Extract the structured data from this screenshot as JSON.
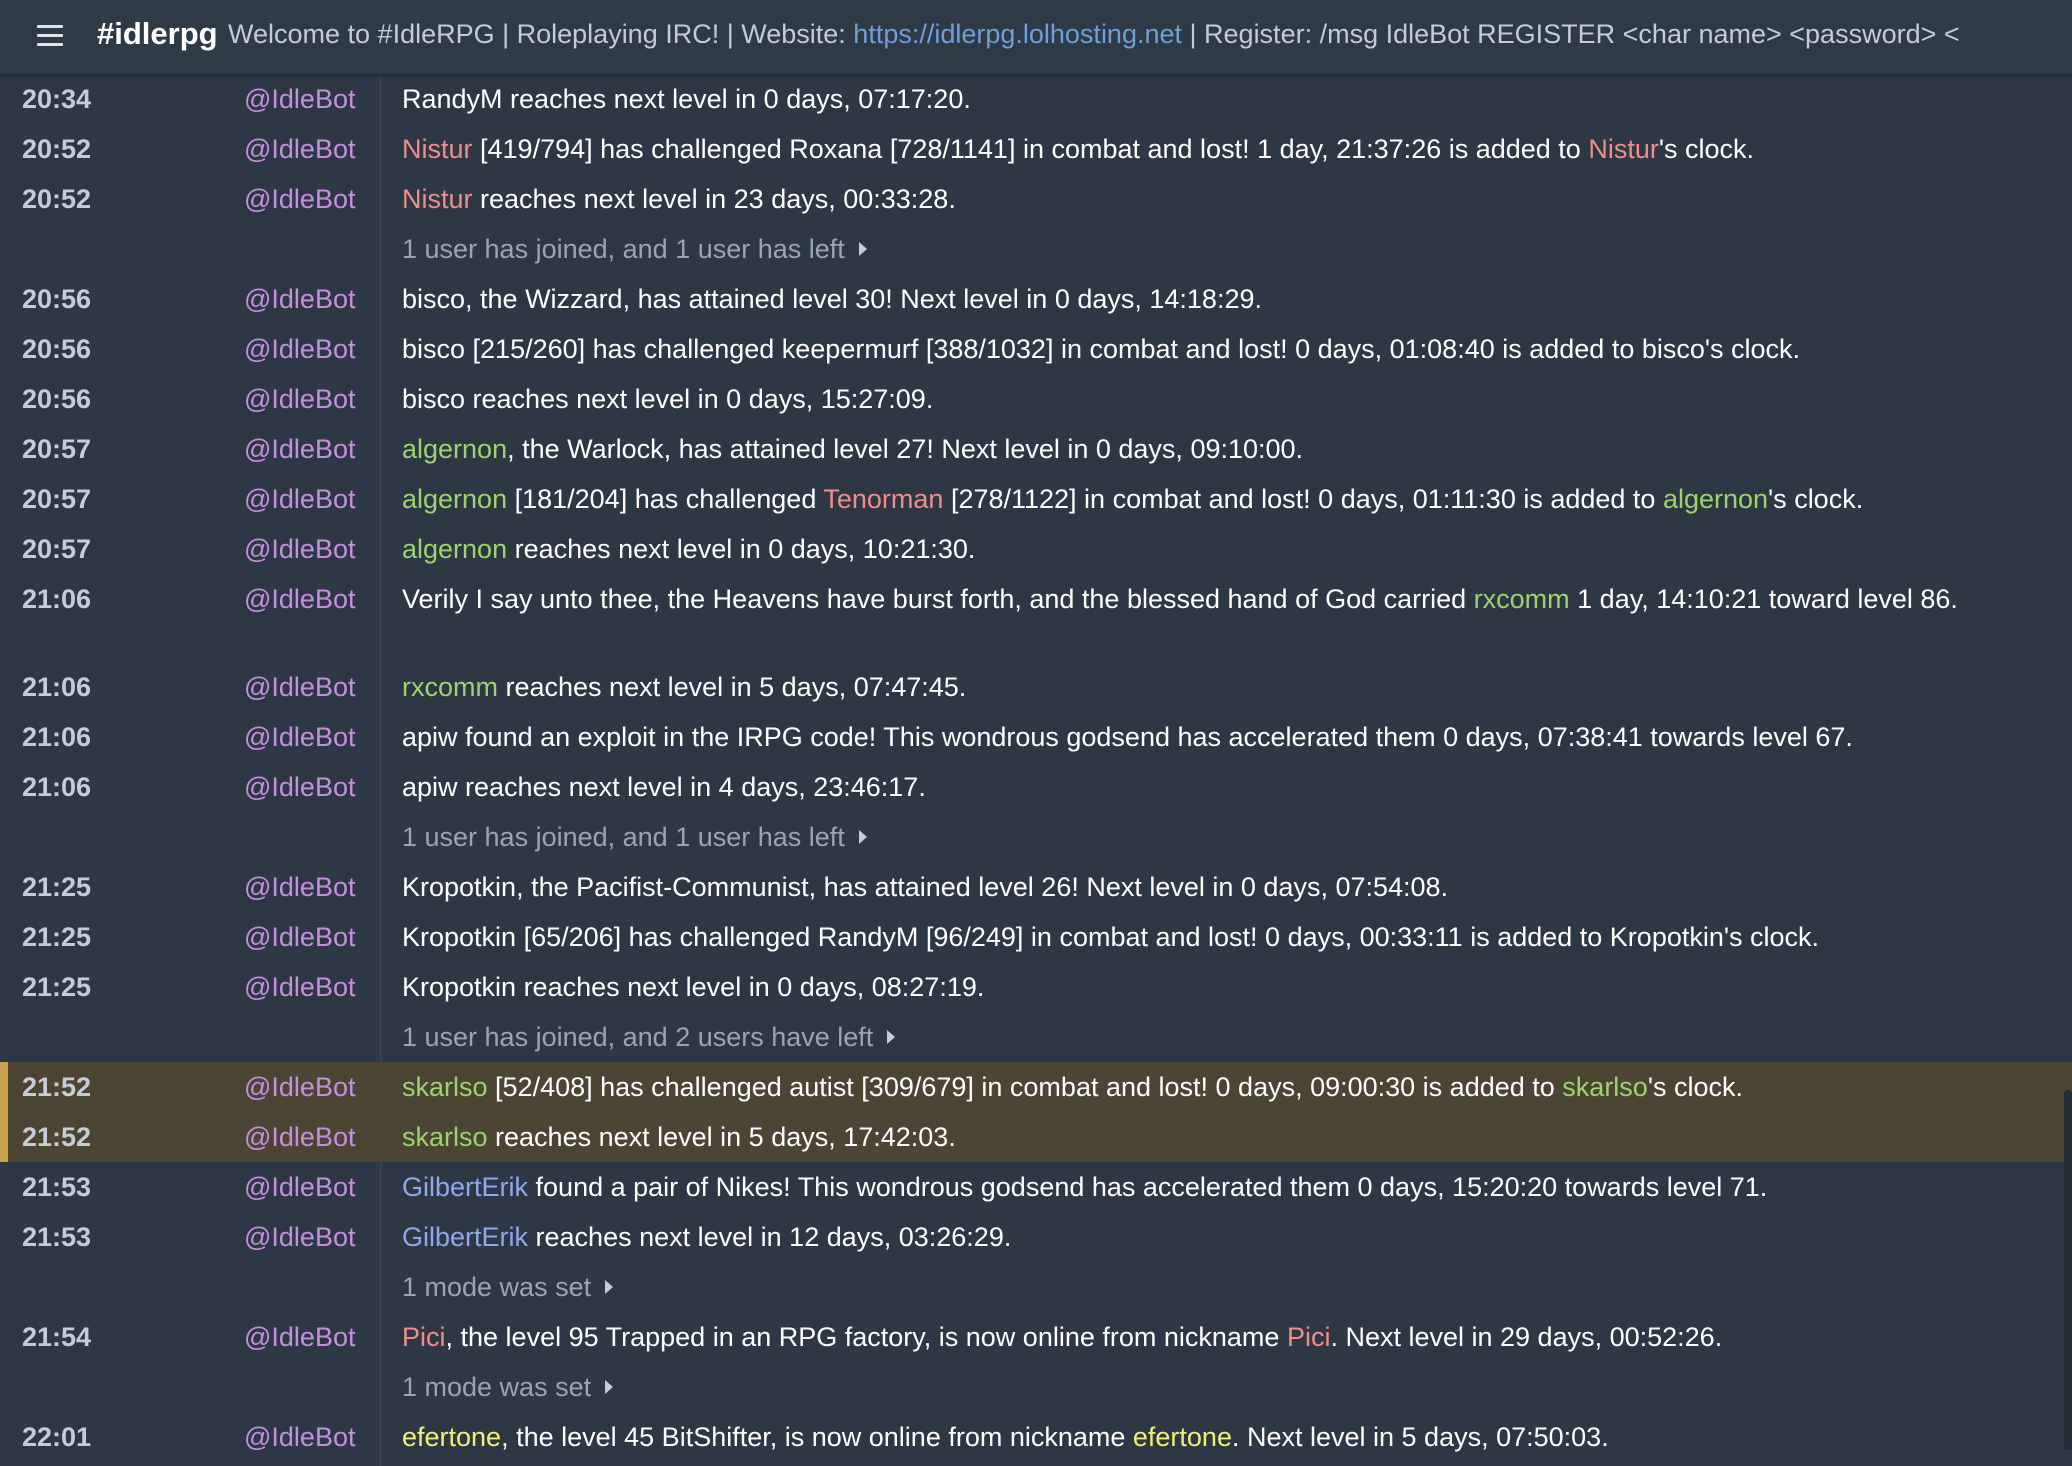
{
  "header": {
    "channel": "#idlerpg",
    "topic_pre": "Welcome to #IdleRPG | Roleplaying IRC! | Website: ",
    "topic_link": "https://idlerpg.lolhosting.net",
    "topic_post": " | Register: /msg IdleBot REGISTER <char name> <password> <"
  },
  "nick_colors": {
    "red": "#ef8d8d",
    "green": "#9bd36f",
    "blue": "#8ea8ec",
    "yellow": "#f0ee7a",
    "bot": "#c58fe0"
  },
  "rows": [
    {
      "ts": "20:34",
      "nick": "@IdleBot",
      "parts": [
        {
          "t": "RandyM reaches next level in 0 days, 07:17:20."
        }
      ]
    },
    {
      "ts": "20:52",
      "nick": "@IdleBot",
      "parts": [
        {
          "t": "Nistur",
          "c": "red"
        },
        {
          "t": " [419/794] has challenged Roxana [728/1141] in combat and lost! 1 day, 21:37:26 is added to "
        },
        {
          "t": "Nistur",
          "c": "red"
        },
        {
          "t": "'s clock."
        }
      ]
    },
    {
      "ts": "20:52",
      "nick": "@IdleBot",
      "parts": [
        {
          "t": "Nistur",
          "c": "red"
        },
        {
          "t": " reaches next level in 23 days, 00:33:28."
        }
      ]
    },
    {
      "sys": "1 user has joined, and 1 user has left"
    },
    {
      "ts": "20:56",
      "nick": "@IdleBot",
      "parts": [
        {
          "t": "bisco, the Wizzard, has attained level 30! Next level in 0 days, 14:18:29."
        }
      ]
    },
    {
      "ts": "20:56",
      "nick": "@IdleBot",
      "parts": [
        {
          "t": "bisco [215/260] has challenged keepermurf [388/1032] in combat and lost! 0 days, 01:08:40 is added to bisco's clock."
        }
      ]
    },
    {
      "ts": "20:56",
      "nick": "@IdleBot",
      "parts": [
        {
          "t": "bisco reaches next level in 0 days, 15:27:09."
        }
      ]
    },
    {
      "ts": "20:57",
      "nick": "@IdleBot",
      "parts": [
        {
          "t": "algernon",
          "c": "green"
        },
        {
          "t": ", the Warlock, has attained level 27! Next level in 0 days, 09:10:00."
        }
      ]
    },
    {
      "ts": "20:57",
      "nick": "@IdleBot",
      "parts": [
        {
          "t": "algernon",
          "c": "green"
        },
        {
          "t": " [181/204] has challenged "
        },
        {
          "t": "Tenorman",
          "c": "red"
        },
        {
          "t": " [278/1122] in combat and lost! 0 days, 01:11:30 is added to "
        },
        {
          "t": "algernon",
          "c": "green"
        },
        {
          "t": "'s clock."
        }
      ]
    },
    {
      "ts": "20:57",
      "nick": "@IdleBot",
      "parts": [
        {
          "t": "algernon",
          "c": "green"
        },
        {
          "t": " reaches next level in 0 days, 10:21:30."
        }
      ]
    },
    {
      "ts": "21:06",
      "nick": "@IdleBot",
      "tall": true,
      "parts": [
        {
          "t": "Verily I say unto thee, the Heavens have burst forth, and the blessed hand of God carried "
        },
        {
          "t": "rxcomm",
          "c": "green"
        },
        {
          "t": " 1 day, 14:10:21 toward level 86."
        }
      ]
    },
    {
      "ts": "21:06",
      "nick": "@IdleBot",
      "parts": [
        {
          "t": "rxcomm",
          "c": "green"
        },
        {
          "t": " reaches next level in 5 days, 07:47:45."
        }
      ]
    },
    {
      "ts": "21:06",
      "nick": "@IdleBot",
      "parts": [
        {
          "t": "apiw found an exploit in the IRPG code! This wondrous godsend has accelerated them 0 days, 07:38:41 towards level 67."
        }
      ]
    },
    {
      "ts": "21:06",
      "nick": "@IdleBot",
      "parts": [
        {
          "t": "apiw reaches next level in 4 days, 23:46:17."
        }
      ]
    },
    {
      "sys": "1 user has joined, and 1 user has left"
    },
    {
      "ts": "21:25",
      "nick": "@IdleBot",
      "parts": [
        {
          "t": "Kropotkin, the Pacifist-Communist, has attained level 26! Next level in 0 days, 07:54:08."
        }
      ]
    },
    {
      "ts": "21:25",
      "nick": "@IdleBot",
      "parts": [
        {
          "t": "Kropotkin [65/206] has challenged RandyM [96/249] in combat and lost! 0 days, 00:33:11 is added to Kropotkin's clock."
        }
      ]
    },
    {
      "ts": "21:25",
      "nick": "@IdleBot",
      "parts": [
        {
          "t": "Kropotkin reaches next level in 0 days, 08:27:19."
        }
      ]
    },
    {
      "sys": "1 user has joined, and 2 users have left"
    },
    {
      "ts": "21:52",
      "nick": "@IdleBot",
      "hl": true,
      "parts": [
        {
          "t": "skarlso",
          "c": "green"
        },
        {
          "t": " [52/408] has challenged autist [309/679] in combat and lost! 0 days, 09:00:30 is added to "
        },
        {
          "t": "skarlso",
          "c": "green"
        },
        {
          "t": "'s clock."
        }
      ]
    },
    {
      "ts": "21:52",
      "nick": "@IdleBot",
      "hl": true,
      "parts": [
        {
          "t": "skarlso",
          "c": "green"
        },
        {
          "t": " reaches next level in 5 days, 17:42:03."
        }
      ]
    },
    {
      "ts": "21:53",
      "nick": "@IdleBot",
      "parts": [
        {
          "t": "GilbertErik",
          "c": "blue"
        },
        {
          "t": " found a pair of Nikes! This wondrous godsend has accelerated them 0 days, 15:20:20 towards level 71."
        }
      ]
    },
    {
      "ts": "21:53",
      "nick": "@IdleBot",
      "parts": [
        {
          "t": "GilbertErik",
          "c": "blue"
        },
        {
          "t": " reaches next level in 12 days, 03:26:29."
        }
      ]
    },
    {
      "sys": "1 mode was set"
    },
    {
      "ts": "21:54",
      "nick": "@IdleBot",
      "parts": [
        {
          "t": "Pici",
          "c": "red"
        },
        {
          "t": ", the level 95 Trapped in an RPG factory, is now online from nickname "
        },
        {
          "t": "Pici",
          "c": "red"
        },
        {
          "t": ". Next level in 29 days, 00:52:26."
        }
      ]
    },
    {
      "sys": "1 mode was set"
    },
    {
      "ts": "22:01",
      "nick": "@IdleBot",
      "parts": [
        {
          "t": "efertone",
          "c": "yellow"
        },
        {
          "t": ", the level 45 BitShifter, is now online from nickname "
        },
        {
          "t": "efertone",
          "c": "yellow"
        },
        {
          "t": ". Next level in 5 days, 07:50:03."
        }
      ]
    }
  ]
}
